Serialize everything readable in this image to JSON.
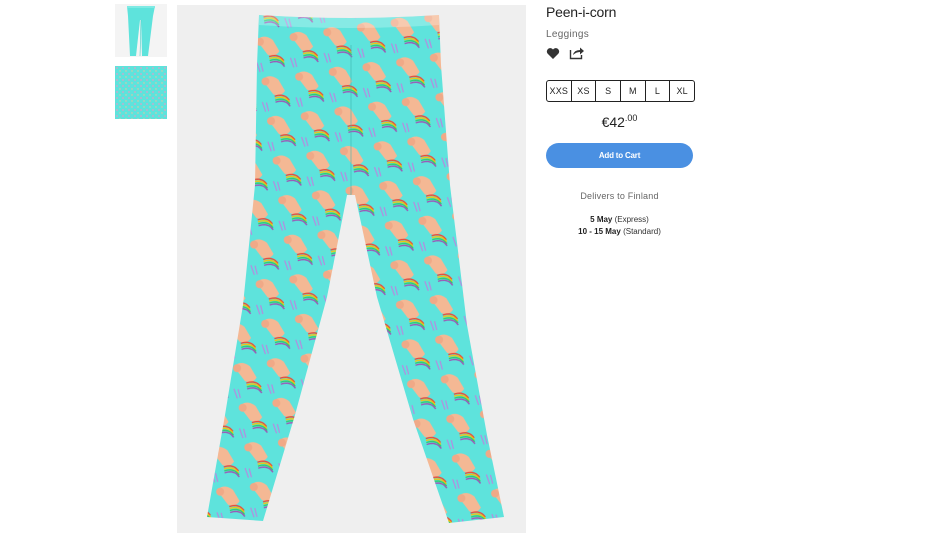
{
  "product": {
    "title": "Peen-i-corn",
    "type": "Leggings",
    "sizes": [
      "XXS",
      "XS",
      "S",
      "M",
      "L",
      "XL"
    ],
    "price_main": "€42",
    "price_cents": ".00",
    "add_to_cart": "Add to Cart"
  },
  "delivery": {
    "heading": "Delivers to Finland",
    "express_date": "5 May",
    "express_label": "(Express)",
    "standard_date": "10 - 15 May",
    "standard_label": "(Standard)"
  },
  "icons": {
    "favorite": "heart-icon",
    "share": "share-icon"
  },
  "colors": {
    "legging_base": "#5ee3dc",
    "button": "#4a90e2",
    "image_bg": "#efefef"
  }
}
